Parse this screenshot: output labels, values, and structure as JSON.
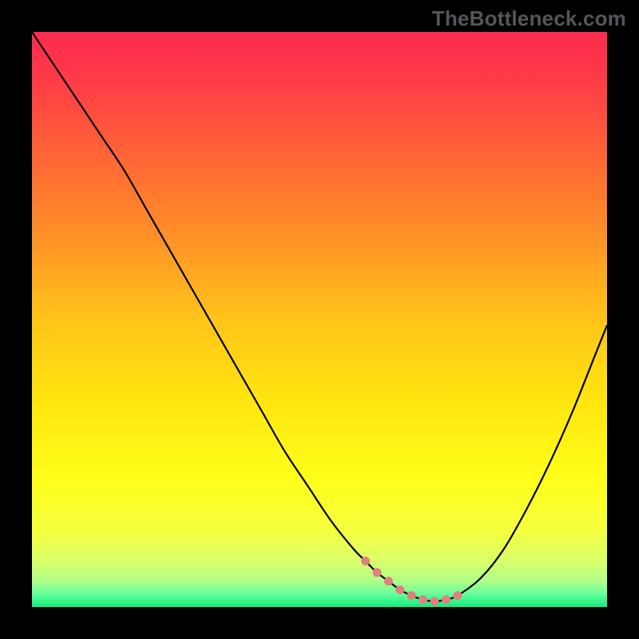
{
  "watermark": "TheBottleneck.com",
  "colors": {
    "background_black": "#000000",
    "curve_stroke": "#000000",
    "marker_fill": "#e28080",
    "gradient_stops": [
      {
        "offset": 0.0,
        "color": "#ff2b4f"
      },
      {
        "offset": 0.08,
        "color": "#ff3a48"
      },
      {
        "offset": 0.2,
        "color": "#ff6038"
      },
      {
        "offset": 0.35,
        "color": "#ff8f28"
      },
      {
        "offset": 0.5,
        "color": "#ffc41a"
      },
      {
        "offset": 0.65,
        "color": "#ffe70f"
      },
      {
        "offset": 0.78,
        "color": "#ffff1a"
      },
      {
        "offset": 0.87,
        "color": "#f4ff40"
      },
      {
        "offset": 0.92,
        "color": "#d9ff6a"
      },
      {
        "offset": 0.955,
        "color": "#b0ff88"
      },
      {
        "offset": 0.975,
        "color": "#6fff9c"
      },
      {
        "offset": 0.99,
        "color": "#34f58c"
      },
      {
        "offset": 1.0,
        "color": "#18e676"
      }
    ]
  },
  "chart_data": {
    "type": "line",
    "title": "",
    "xlabel": "",
    "ylabel": "",
    "xlim": [
      0,
      100
    ],
    "ylim": [
      0,
      100
    ],
    "series": [
      {
        "name": "bottleneck-curve",
        "x": [
          0,
          4,
          8,
          12,
          16,
          20,
          24,
          28,
          32,
          36,
          40,
          44,
          48,
          52,
          56,
          58,
          60,
          62,
          64,
          66,
          68,
          70,
          72,
          74,
          78,
          82,
          86,
          90,
          94,
          98,
          100
        ],
        "values": [
          100,
          94,
          88,
          82,
          76,
          69,
          62,
          55,
          48,
          41,
          34,
          27,
          21,
          15,
          10,
          8,
          6,
          4.5,
          3,
          2,
          1.3,
          1,
          1.3,
          2,
          5,
          10,
          17,
          25,
          34,
          44,
          49
        ]
      }
    ],
    "markers": {
      "name": "flat-region-points",
      "x": [
        58,
        60,
        62,
        64,
        66,
        68,
        70,
        72,
        74
      ],
      "values": [
        8,
        6,
        4.5,
        3,
        2,
        1.3,
        1,
        1.3,
        2
      ]
    }
  }
}
